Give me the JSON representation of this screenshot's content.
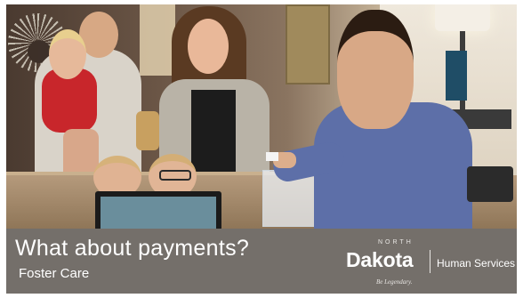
{
  "slide": {
    "title": "What about payments?",
    "subtitle": "Foster Care"
  },
  "logo": {
    "state_small": "NORTH",
    "state_large": "Dakota",
    "tagline": "Be Legendary.",
    "department": "Human Services"
  },
  "colors": {
    "banner": "#78746f",
    "text": "#ffffff",
    "worker_shirt": "#5d6fa8",
    "child_shirt": "#c8262b"
  }
}
